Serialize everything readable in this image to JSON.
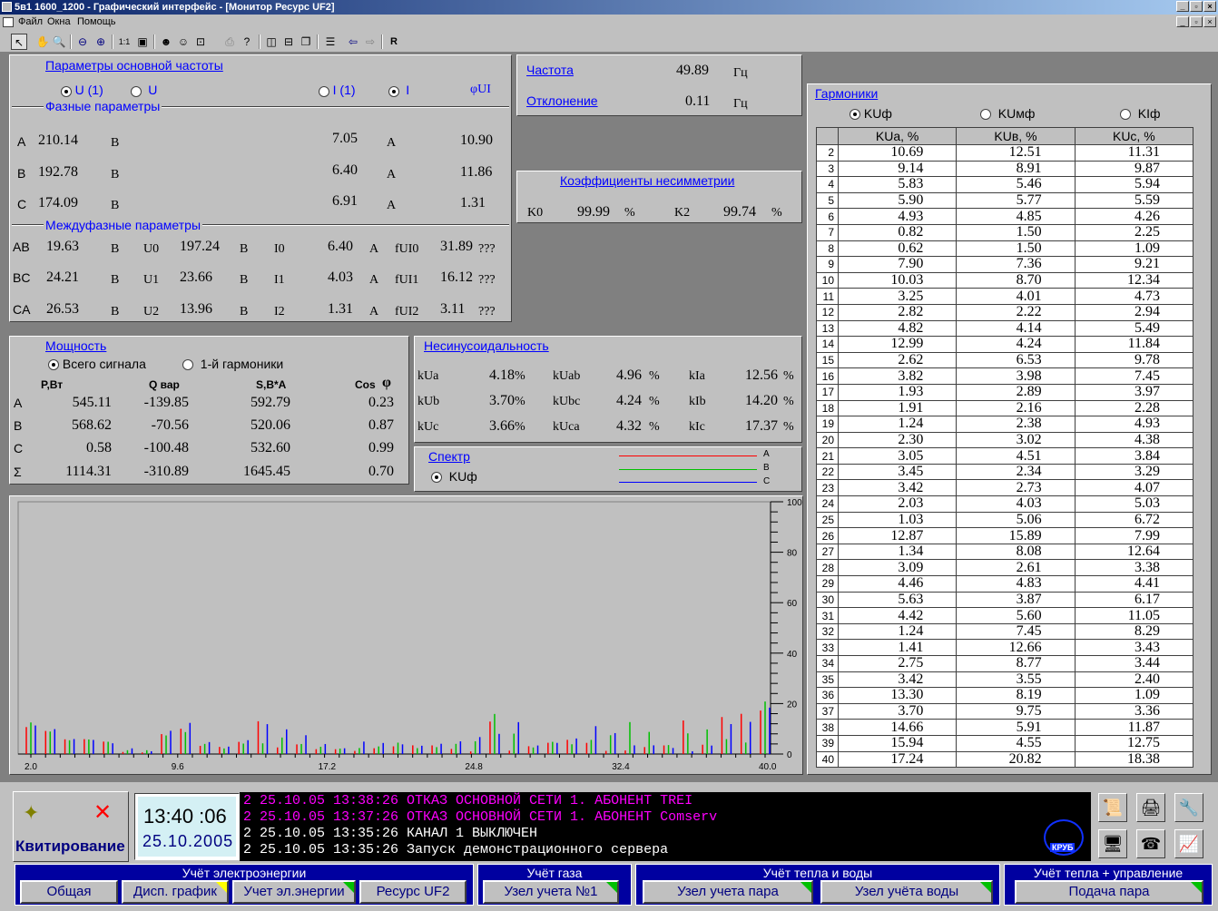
{
  "window": {
    "title": "5в1 1600_1200 - Графический интерфейс - [Монитор Ресурс UF2]"
  },
  "menu": {
    "file": "Файл",
    "windows": "Окна",
    "help": "Помощь"
  },
  "fundamental": {
    "title": "Параметры основной частоты",
    "u1": "U (1)",
    "u": "U",
    "i1": "I (1)",
    "i": "I",
    "phi": "φUI",
    "phase_title": "Фазные параметры",
    "interphase_title": "Междуфазные параметры",
    "phase": [
      {
        "name": "A",
        "u": "210.14",
        "uu": "В",
        "i": "7.05",
        "iu": "А",
        "phi": "10.90"
      },
      {
        "name": "B",
        "u": "192.78",
        "uu": "В",
        "i": "6.40",
        "iu": "А",
        "phi": "11.86"
      },
      {
        "name": "C",
        "u": "174.09",
        "uu": "В",
        "i": "6.91",
        "iu": "А",
        "phi": "1.31"
      }
    ],
    "inter": [
      {
        "name": "AB",
        "u": "19.63",
        "uu": "В",
        "sym": "U0",
        "sv": "197.24",
        "su": "В",
        "ilbl": "I0",
        "iv": "6.40",
        "iu": "А",
        "flbl": "fUI0",
        "fv": "31.89",
        "fu": "???"
      },
      {
        "name": "BC",
        "u": "24.21",
        "uu": "В",
        "sym": "U1",
        "sv": "23.66",
        "su": "В",
        "ilbl": "I1",
        "iv": "4.03",
        "iu": "А",
        "flbl": "fUI1",
        "fv": "16.12",
        "fu": "???"
      },
      {
        "name": "CA",
        "u": "26.53",
        "uu": "В",
        "sym": "U2",
        "sv": "13.96",
        "su": "В",
        "ilbl": "I2",
        "iv": "1.31",
        "iu": "А",
        "flbl": "fUI2",
        "fv": "3.11",
        "fu": "???"
      }
    ]
  },
  "frequency": {
    "freq_label": "Частота",
    "freq": "49.89",
    "freq_unit": "Гц",
    "dev_label": "Отклонение",
    "dev": "0.11",
    "dev_unit": "Гц"
  },
  "asym": {
    "title": "Коэффициенты несимметрии",
    "k0": "K0",
    "k0v": "99.99",
    "k0u": "%",
    "k2": "K2",
    "k2v": "99.74",
    "k2u": "%"
  },
  "power": {
    "title": "Мощность",
    "all": "Всего сигнала",
    "first": "1-й гармоники",
    "h_p": "P,Вт",
    "h_q": "Q вар",
    "h_s": "S,В*А",
    "h_cos": "Cos",
    "h_phi": "φ",
    "rows": [
      {
        "n": "A",
        "p": "545.11",
        "q": "-139.85",
        "s": "592.79",
        "c": "0.23"
      },
      {
        "n": "B",
        "p": "568.62",
        "q": "-70.56",
        "s": "520.06",
        "c": "0.87"
      },
      {
        "n": "C",
        "p": "0.58",
        "q": "-100.48",
        "s": "532.60",
        "c": "0.99"
      },
      {
        "n": "Σ",
        "p": "1114.31",
        "q": "-310.89",
        "s": "1645.45",
        "c": "0.70"
      }
    ]
  },
  "nonsin": {
    "title": "Несинусоидальность",
    "rows": [
      {
        "a": "kUa",
        "av": "4.18",
        "b": "kUab",
        "bv": "4.96",
        "c": "kIa",
        "cv": "12.56"
      },
      {
        "a": "kUb",
        "av": "3.70",
        "b": "kUbc",
        "bv": "4.24",
        "c": "kIb",
        "cv": "14.20"
      },
      {
        "a": "kUc",
        "av": "3.66",
        "b": "kUca",
        "bv": "4.32",
        "c": "kIc",
        "cv": "17.37"
      }
    ],
    "pct": "%"
  },
  "spectrum": {
    "title": "Спектр",
    "mode": "KUф",
    "legend": [
      "A",
      "B",
      "C"
    ],
    "colors": [
      "#ff0000",
      "#00c000",
      "#0000ff"
    ]
  },
  "harmonics": {
    "title": "Гармоники",
    "opts": [
      "KUф",
      "KUмф",
      "KIф"
    ],
    "headers": [
      "KUa, %",
      "KUв, %",
      "KUc, %"
    ],
    "rows": [
      [
        "2",
        "10.69",
        "12.51",
        "11.31"
      ],
      [
        "3",
        "9.14",
        "8.91",
        "9.87"
      ],
      [
        "4",
        "5.83",
        "5.46",
        "5.94"
      ],
      [
        "5",
        "5.90",
        "5.77",
        "5.59"
      ],
      [
        "6",
        "4.93",
        "4.85",
        "4.26"
      ],
      [
        "7",
        "0.82",
        "1.50",
        "2.25"
      ],
      [
        "8",
        "0.62",
        "1.50",
        "1.09"
      ],
      [
        "9",
        "7.90",
        "7.36",
        "9.21"
      ],
      [
        "10",
        "10.03",
        "8.70",
        "12.34"
      ],
      [
        "11",
        "3.25",
        "4.01",
        "4.73"
      ],
      [
        "12",
        "2.82",
        "2.22",
        "2.94"
      ],
      [
        "13",
        "4.82",
        "4.14",
        "5.49"
      ],
      [
        "14",
        "12.99",
        "4.24",
        "11.84"
      ],
      [
        "15",
        "2.62",
        "6.53",
        "9.78"
      ],
      [
        "16",
        "3.82",
        "3.98",
        "7.45"
      ],
      [
        "17",
        "1.93",
        "2.89",
        "3.97"
      ],
      [
        "18",
        "1.91",
        "2.16",
        "2.28"
      ],
      [
        "19",
        "1.24",
        "2.38",
        "4.93"
      ],
      [
        "20",
        "2.30",
        "3.02",
        "4.38"
      ],
      [
        "21",
        "3.05",
        "4.51",
        "3.84"
      ],
      [
        "22",
        "3.45",
        "2.34",
        "3.29"
      ],
      [
        "23",
        "3.42",
        "2.73",
        "4.07"
      ],
      [
        "24",
        "2.03",
        "4.03",
        "5.03"
      ],
      [
        "25",
        "1.03",
        "5.06",
        "6.72"
      ],
      [
        "26",
        "12.87",
        "15.89",
        "7.99"
      ],
      [
        "27",
        "1.34",
        "8.08",
        "12.64"
      ],
      [
        "28",
        "3.09",
        "2.61",
        "3.38"
      ],
      [
        "29",
        "4.46",
        "4.83",
        "4.41"
      ],
      [
        "30",
        "5.63",
        "3.87",
        "6.17"
      ],
      [
        "31",
        "4.42",
        "5.60",
        "11.05"
      ],
      [
        "32",
        "1.24",
        "7.45",
        "8.29"
      ],
      [
        "33",
        "1.41",
        "12.66",
        "3.43"
      ],
      [
        "34",
        "2.75",
        "8.77",
        "3.44"
      ],
      [
        "35",
        "3.42",
        "3.55",
        "2.40"
      ],
      [
        "36",
        "13.30",
        "8.19",
        "1.09"
      ],
      [
        "37",
        "3.70",
        "9.75",
        "3.36"
      ],
      [
        "38",
        "14.66",
        "5.91",
        "11.87"
      ],
      [
        "39",
        "15.94",
        "4.55",
        "12.75"
      ],
      [
        "40",
        "17.24",
        "20.82",
        "18.38"
      ]
    ]
  },
  "chart_data": {
    "type": "bar",
    "x_ticks": [
      "2.0",
      "9.6",
      "17.2",
      "24.8",
      "32.4",
      "40.0"
    ],
    "y_ticks": [
      "0",
      "20",
      "40",
      "60",
      "80",
      "100"
    ],
    "ylim": [
      0,
      100
    ],
    "xlim": [
      2,
      40
    ],
    "series_source": "harmonics.rows"
  },
  "status": {
    "ack": "Квитирование",
    "time": "13:40 :06",
    "date": "25.10.2005",
    "kru": "КРУБ",
    "log": [
      {
        "text": "2  25.10.05 13:38:26 ОТКАЗ ОСНОВНОЙ СЕТИ 1. АБОНЕНТ TREI",
        "color": "#ff00ff"
      },
      {
        "text": "2  25.10.05 13:37:26 ОТКАЗ ОСНОВНОЙ СЕТИ 1. АБОНЕНТ Comserv",
        "color": "#ff00ff"
      },
      {
        "text": "2  25.10.05 13:35:26 КАНАЛ 1 ВЫКЛЮЧЕН",
        "color": "#ffffff"
      },
      {
        "text": "2  25.10.05 13:35:26 Запуск демонстрационного сервера",
        "color": "#ffffff"
      }
    ]
  },
  "nav": {
    "g1": "Учёт электроэнергии",
    "b1": "Общая",
    "b2": "Дисп. график",
    "b3": "Учет эл.энергии",
    "b4": "Ресурс UF2",
    "g2": "Учёт газа",
    "b5": "Узел учета №1",
    "g3": "Учёт тепла и воды",
    "b6": "Узел учета пара",
    "b7": "Узел учёта воды",
    "g4": "Учёт тепла + управление",
    "b8": "Подача пара"
  }
}
